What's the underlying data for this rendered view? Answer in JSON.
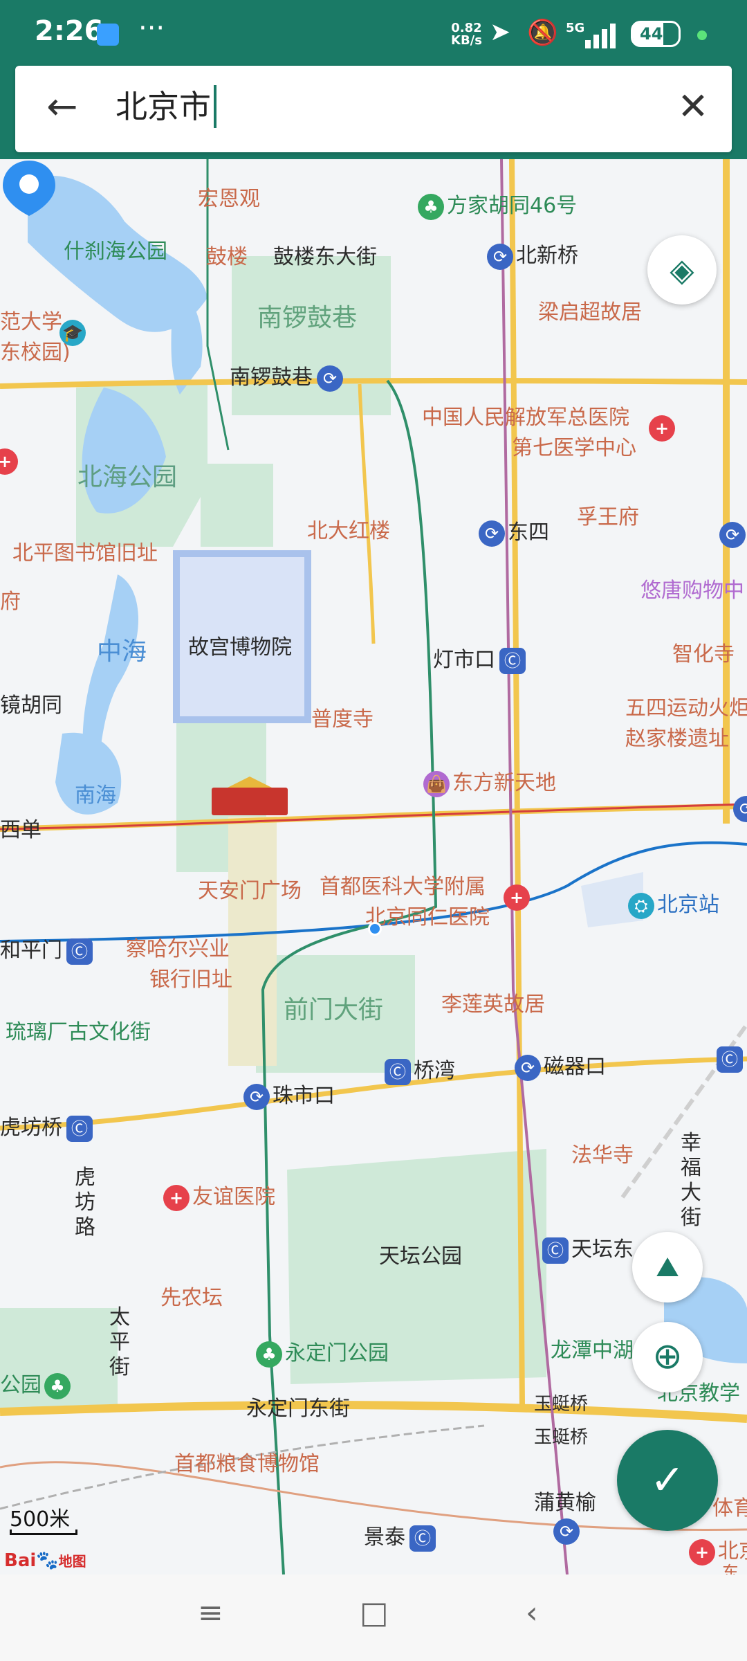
{
  "status_bar": {
    "time": "2:26",
    "overflow": "···",
    "net_speed_value": "0.82",
    "net_speed_unit": "KB/s",
    "signal": "5G",
    "battery": "44"
  },
  "search": {
    "query": "北京市"
  },
  "map": {
    "labels": {
      "hongen_temple": "宏恩观",
      "fangjia_hutong": "方家胡同46号",
      "shichahai_park": "什刹海公园",
      "gulou": "鼓楼",
      "gulou_east_street": "鼓楼东大街",
      "beixinqiao": "北新桥",
      "normal_univ_1": "范大学",
      "normal_univ_2": "东校园)",
      "nanluoguxiang_area": "南锣鼓巷",
      "liang_residence": "梁启超故居",
      "nanluoguxiang_station": "南锣鼓巷",
      "pla_hospital_1": "中国人民解放军总医院",
      "pla_hospital_2": "第七医学中心",
      "beihai_park": "北海公园",
      "fuwang_mansion": "孚王府",
      "beidahonglou": "北大红楼",
      "dongsi": "东四",
      "beiping_library": "北平图书馆旧址",
      "youtang_mall": "悠唐购物中",
      "fu_left": "府",
      "zhonghai": "中海",
      "palace_museum": "故宫博物院",
      "dengshikou": "灯市口",
      "zhihua_temple": "智化寺",
      "jing_hutong": "镜胡同",
      "pudu_temple": "普度寺",
      "may4th_1": "五四运动火炬",
      "may4th_2": "赵家楼遗址",
      "nanhai": "南海",
      "oriental_plaza": "东方新天地",
      "xidan": "西单",
      "tiananmen_square": "天安门广场",
      "tongren_1": "首都医科大学附属",
      "tongren_2": "北京同仁医院",
      "beijing_station": "北京站",
      "hepingmen": "和平门",
      "chahaer_1": "察哈尔兴业",
      "chahaer_2": "银行旧址",
      "qianmen_street": "前门大街",
      "lilianying": "李莲英故居",
      "liulichang": "琉璃厂古文化街",
      "qiaowan": "桥湾",
      "ciqikou": "磁器口",
      "zhushikou": "珠市口",
      "hufangqiao": "虎坊桥",
      "fahua_temple": "法华寺",
      "hufang_road": "虎坊路",
      "xingfu_street": "幸福大街",
      "friendship_hospital": "友谊医院",
      "temple_of_heaven": "天坛公园",
      "tiantan_east": "天坛东",
      "xiannongtan": "先农坛",
      "taiping_street": "太平街",
      "yongdingmen_park": "永定门公园",
      "longtan_lake": "龙潭中湖",
      "gongyuan_left": "公园",
      "bj_education": "北京教学",
      "yongdingmen_east": "永定门东街",
      "yuyingqiao_1": "玉蜓桥",
      "yuyingqiao_2": "玉蜓桥",
      "grain_museum": "首都粮食博物馆",
      "puhuangyu": "蒲黄榆",
      "jingtai": "景泰",
      "sports_right": "体育",
      "bj_right": "北京",
      "bj_right2": "东"
    },
    "scale": "500米",
    "logo_text": "Bai",
    "logo_suffix": "地图"
  },
  "colors": {
    "theme": "#1a7a66",
    "pin": "#2f8ff0"
  }
}
